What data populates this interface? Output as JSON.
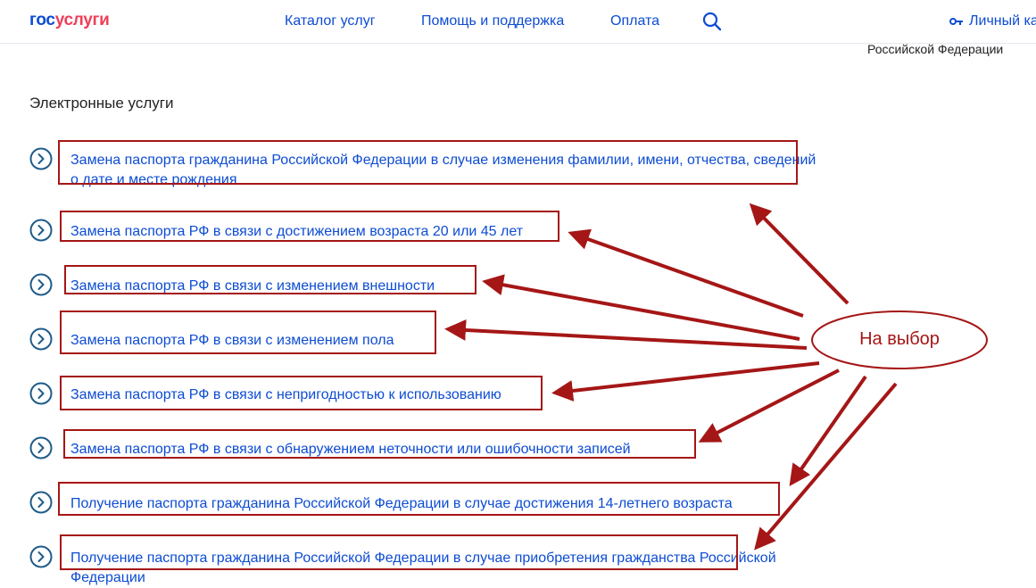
{
  "header": {
    "logo_part1": "гос",
    "logo_part2": "услуги",
    "nav": [
      "Каталог услуг",
      "Помощь и поддержка",
      "Оплата"
    ],
    "login_label": "Личный кабинет"
  },
  "breadcrumb_fragment": "Российской Федерации",
  "section_title": "Электронные услуги",
  "services": [
    "Замена паспорта гражданина Российской Федерации в случае изменения фамилии, имени, отчества, сведений о дате и месте рождения",
    "Замена паспорта РФ в связи с достижением возраста 20 или 45 лет",
    "Замена паспорта РФ в связи с изменением внешности",
    "Замена паспорта РФ в связи с изменением пола",
    "Замена паспорта РФ в связи с непригодностью к использованию",
    "Замена паспорта РФ в связи с обнаружением неточности или ошибочности записей",
    "Получение паспорта гражданина Российской Федерации в случае достижения 14-летнего возраста",
    "Получение паспорта гражданина Российской Федерации в случае приобретения гражданства Российской Федерации"
  ],
  "annotation": {
    "label": "На выбор",
    "color": "#a51616"
  },
  "colors": {
    "link": "#0d4cd3",
    "brand_red": "#ee3f58",
    "icon": "#1f5c8a"
  }
}
